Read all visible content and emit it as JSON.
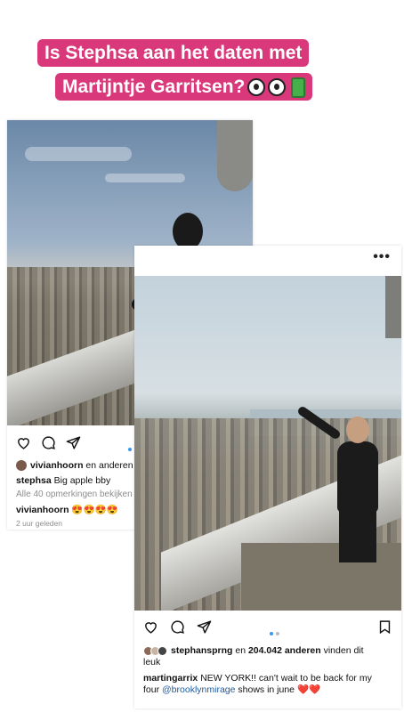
{
  "headline": {
    "line1": "Is Stephsa aan het daten met",
    "line2": "Martijntje Garritsen?"
  },
  "post1": {
    "likes_user": "vivianhoorn",
    "likes_rest": " en anderen vinden dit leuk",
    "caption_user": "stephsa",
    "caption_text": " Big apple bby",
    "view_comments": "Alle 40 opmerkingen bekijken",
    "comment_user": "vivianhoorn",
    "comment_text": " 😍😍😍😍",
    "time": "2 uur geleden"
  },
  "post2": {
    "more": "•••",
    "likes_user": "stephansprng",
    "likes_mid": " en ",
    "likes_count": "204.042 anderen",
    "likes_rest_1": " vinden dit",
    "likes_rest_2": "leuk",
    "caption_user": "martingarrix",
    "caption_line1": " NEW YORK!! can't wait to be back for my",
    "caption_line2_a": "four ",
    "caption_mention": "@brooklynmirage",
    "caption_line2_b": " shows in june ",
    "caption_hearts": "❤️❤️"
  },
  "colors": {
    "headline_bg": "#d9397a",
    "link": "#1c5a9e",
    "active_dot": "#3897f0"
  }
}
